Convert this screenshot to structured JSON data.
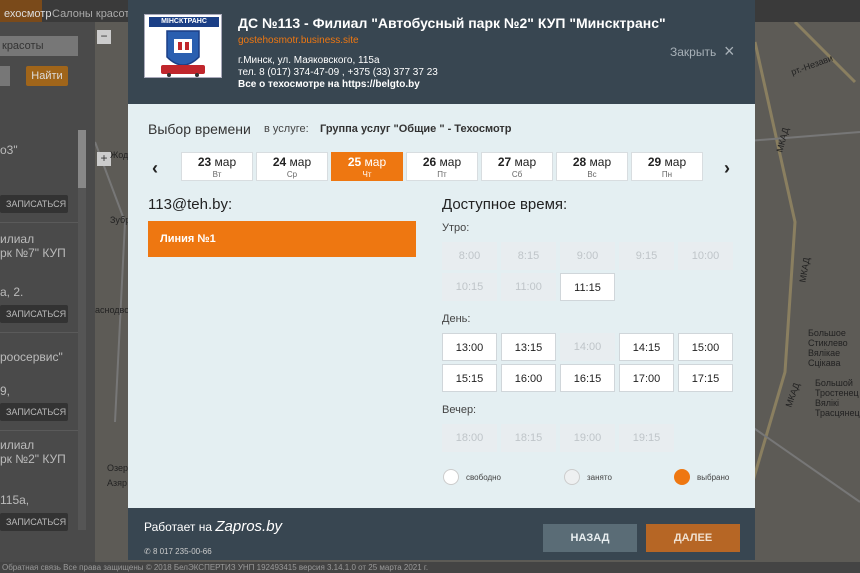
{
  "background": {
    "tabs": [
      "ехосмотр",
      "Салоны красоты"
    ],
    "search_value": "красоты",
    "find_button": "Найти",
    "items": [
      "о3\"",
      "илиал\nрк №7\" КУП",
      "а, 2.",
      "роосервис\"",
      "9,",
      "илиал\nрк №2\" КУП",
      "115а,"
    ],
    "item_button": "ЗАПИСАТЬСЯ",
    "map_labels": [
      "Жодино",
      "Зубревичи",
      "аснодворцы",
      "МКАД",
      "МКАД",
      "МКАД",
      "Большое\nСтиклево\nВялікае\nСцікава",
      "Большой\nТростенец\nВялікі\nТрасцянец",
      "Озер",
      "Азяр",
      "рт.-Незави"
    ],
    "footer_text": "Обратная связь   Все права защищены © 2018 БелЭКСПЕРТИЗ  УНП 192493415   версия 3.14.1.0 от 25 марта 2021 г."
  },
  "header": {
    "logo_text": "МІНСКТРАНС",
    "title": "ДС №113 - Филиал \"Автобусный парк №2\" КУП \"Минсктранс\"",
    "link": "gostehosmotr.business.site",
    "address": "г.Минск, ул. Маяковского, 115а",
    "phones": "тел. 8 (017) 374-47-09 , +375 (33) 377 37 23",
    "about": "Все о техосмотре на https://belgto.by",
    "close_label": "Закрыть",
    "close_icon": "×"
  },
  "selection": {
    "title": "Выбор времени",
    "service_label": "в услуге:",
    "service": "Группа услуг \"Общие \" - Техосмотр"
  },
  "dates": [
    {
      "day": "23",
      "month": "мар",
      "weekday": "Вт",
      "selected": false
    },
    {
      "day": "24",
      "month": "мар",
      "weekday": "Ср",
      "selected": false
    },
    {
      "day": "25",
      "month": "мар",
      "weekday": "Чт",
      "selected": true
    },
    {
      "day": "26",
      "month": "мар",
      "weekday": "Пт",
      "selected": false
    },
    {
      "day": "27",
      "month": "мар",
      "weekday": "Сб",
      "selected": false
    },
    {
      "day": "28",
      "month": "мар",
      "weekday": "Вс",
      "selected": false
    },
    {
      "day": "29",
      "month": "мар",
      "weekday": "Пн",
      "selected": false
    }
  ],
  "location": {
    "title": "113@teh.by:",
    "line": "Линия №1"
  },
  "available": {
    "title": "Доступное время:",
    "periods": [
      {
        "label": "Утро:",
        "slots": [
          {
            "time": "8:00",
            "free": false
          },
          {
            "time": "8:15",
            "free": false
          },
          {
            "time": "9:00",
            "free": false
          },
          {
            "time": "9:15",
            "free": false
          },
          {
            "time": "10:00",
            "free": false
          },
          {
            "time": "10:15",
            "free": false
          },
          {
            "time": "11:00",
            "free": false
          },
          {
            "time": "11:15",
            "free": true
          }
        ]
      },
      {
        "label": "День:",
        "slots": [
          {
            "time": "13:00",
            "free": true
          },
          {
            "time": "13:15",
            "free": true
          },
          {
            "time": "14:00",
            "free": false
          },
          {
            "time": "14:15",
            "free": true
          },
          {
            "time": "15:00",
            "free": true
          },
          {
            "time": "15:15",
            "free": true
          },
          {
            "time": "16:00",
            "free": true
          },
          {
            "time": "16:15",
            "free": true
          },
          {
            "time": "17:00",
            "free": true
          },
          {
            "time": "17:15",
            "free": true
          }
        ]
      },
      {
        "label": "Вечер:",
        "slots": [
          {
            "time": "18:00",
            "free": false
          },
          {
            "time": "18:15",
            "free": false
          },
          {
            "time": "19:00",
            "free": false
          },
          {
            "time": "19:15",
            "free": false
          }
        ]
      }
    ]
  },
  "legend": {
    "free": "свободно",
    "busy": "занято",
    "chosen": "выбрано"
  },
  "footer": {
    "powered_label": "Работает на",
    "brand": "Zapros.by",
    "phone": "8 017 235-00-66",
    "back": "НАЗАД",
    "next": "ДАЛЕЕ"
  },
  "colors": {
    "accent": "#ee7711",
    "header": "#384651",
    "panel": "#e4eff2"
  }
}
